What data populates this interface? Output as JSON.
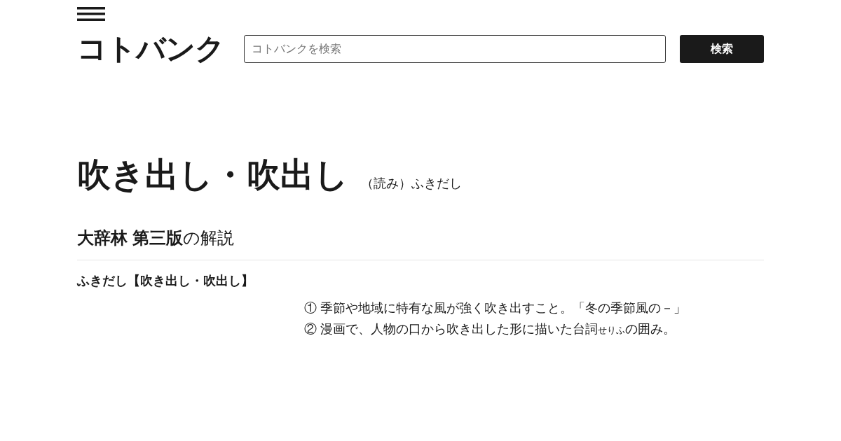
{
  "header": {
    "logo": "コトバンク",
    "search": {
      "placeholder": "コトバンクを検索"
    },
    "search_button": "検索"
  },
  "entry": {
    "title": "吹き出し・吹出し",
    "reading": "（読み）ふきだし"
  },
  "section": {
    "heading": "**大辞林 第三版**の解説",
    "headword": "ふきだし【吹き出し・吹出し】",
    "definitions": [
      {
        "segments": [
          {
            "kind": "normal",
            "text": "① 季節や地域に特有な風が強く吹き出すこと。「冬の季節風の－」"
          }
        ]
      },
      {
        "segments": [
          {
            "kind": "normal",
            "text": "② 漫画で、人物の口から吹き出した形に描いた台詞"
          },
          {
            "kind": "ruby",
            "text": "せりふ"
          },
          {
            "kind": "normal",
            "text": "の囲み。"
          }
        ]
      }
    ]
  }
}
